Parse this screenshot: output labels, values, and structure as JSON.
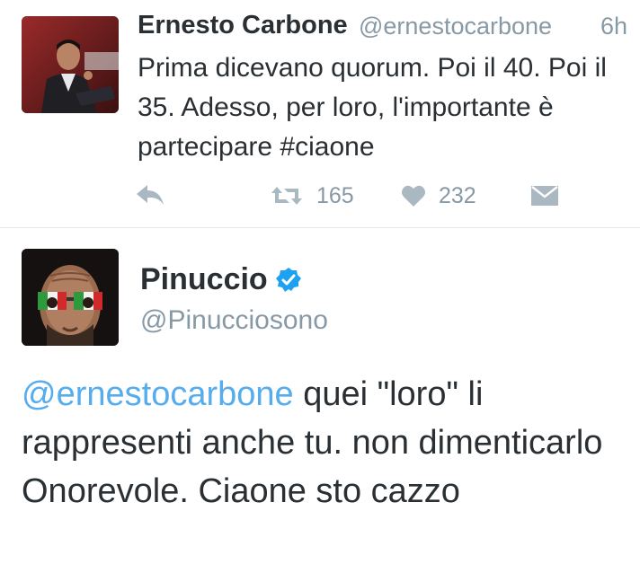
{
  "tweet1": {
    "author_name": "Ernesto Carbone",
    "author_handle": "@ernestocarbone",
    "time": "6h",
    "text": "Prima dicevano quorum. Poi il 40. Poi il 35. Adesso, per loro, l'importante è partecipare #ciaone",
    "retweet_count": "165",
    "like_count": "232"
  },
  "tweet2": {
    "author_name": "Pinuccio",
    "author_handle": "@Pinucciosono",
    "mention": "@ernestocarbone",
    "text": " quei \"loro\" li rappresenti anche tu. non dimenticarlo Onorevole. Ciaone sto cazzo"
  },
  "icons": {
    "reply": "reply-icon",
    "retweet": "retweet-icon",
    "like": "heart-icon",
    "dm": "envelope-icon",
    "verified": "verified-badge-icon"
  },
  "colors": {
    "link": "#55acee",
    "muted": "#8899a6",
    "icon": "#aab8c2",
    "text": "#292f33",
    "verified": "#1da1f2"
  }
}
